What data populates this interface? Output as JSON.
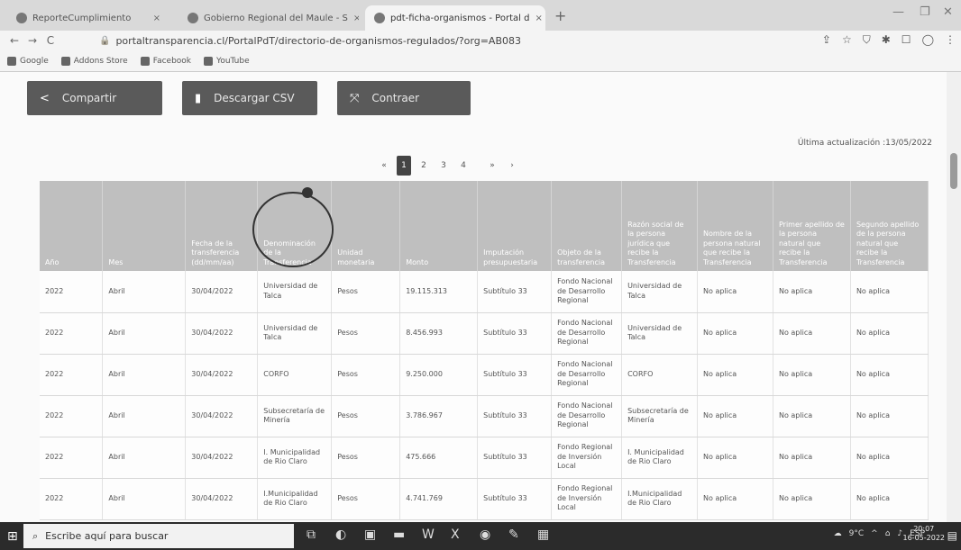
{
  "tabs": [
    {
      "title": "ReporteCumplimiento",
      "close": "×"
    },
    {
      "title": "Gobierno Regional del Maule - S",
      "close": "×"
    },
    {
      "title": "pdt-ficha-organismos - Portal d",
      "close": "×"
    }
  ],
  "window_controls": {
    "new_tab": "+",
    "minimize": "—",
    "restore": "❐",
    "close": "✕"
  },
  "address_bar": {
    "back": "←",
    "forward": "→",
    "reload": "C",
    "url": "portaltransparencia.cl/PortalPdT/directorio-de-organismos-regulados/?org=AB083"
  },
  "bookmarks": [
    "Google",
    "Addons Store",
    "Facebook",
    "YouTube"
  ],
  "actions": {
    "share": {
      "label": "Compartir",
      "icon": "share-icon"
    },
    "csv": {
      "label": "Descargar CSV",
      "icon": "document-icon"
    },
    "collapse": {
      "label": "Contraer",
      "icon": "collapse-icon"
    }
  },
  "last_update": "Última actualización :13/05/2022",
  "pagination": {
    "prev": "«",
    "pages": [
      "1",
      "2",
      "3",
      "4"
    ],
    "active": "1",
    "next_a": "»",
    "next_b": "›"
  },
  "table": {
    "headers": [
      "Año",
      "Mes",
      "Fecha de la transferencia (dd/mm/aa)",
      "Denominación de la Transferencia",
      "Unidad monetaria",
      "Monto",
      "Imputación presupuestaria",
      "Objeto de la transferencia",
      "Razón social de la persona jurídica que recibe la Transferencia",
      "Nombre de la persona natural que recibe la Transferencia",
      "Primer apellido de la persona natural que recibe la Transferencia",
      "Segundo apellido de la persona natural que recibe la Transferencia"
    ],
    "rows": [
      [
        "2022",
        "Abril",
        "30/04/2022",
        "Universidad de Talca",
        "Pesos",
        "19.115.313",
        "Subtítulo 33",
        "Fondo Nacional de Desarrollo Regional",
        "Universidad de Talca",
        "No aplica",
        "No aplica",
        "No aplica"
      ],
      [
        "2022",
        "Abril",
        "30/04/2022",
        "Universidad de Talca",
        "Pesos",
        "8.456.993",
        "Subtítulo 33",
        "Fondo Nacional de Desarrollo Regional",
        "Universidad de Talca",
        "No aplica",
        "No aplica",
        "No aplica"
      ],
      [
        "2022",
        "Abril",
        "30/04/2022",
        "CORFO",
        "Pesos",
        "9.250.000",
        "Subtítulo 33",
        "Fondo Nacional de Desarrollo Regional",
        "CORFO",
        "No aplica",
        "No aplica",
        "No aplica"
      ],
      [
        "2022",
        "Abril",
        "30/04/2022",
        "Subsecretaría de Minería",
        "Pesos",
        "3.786.967",
        "Subtítulo 33",
        "Fondo Nacional de Desarrollo Regional",
        "Subsecretaría de Minería",
        "No aplica",
        "No aplica",
        "No aplica"
      ],
      [
        "2022",
        "Abril",
        "30/04/2022",
        "I. Municipalidad de Rio Claro",
        "Pesos",
        "475.666",
        "Subtítulo 33",
        "Fondo Regional de Inversión Local",
        "I. Municipalidad de Rio Claro",
        "No aplica",
        "No aplica",
        "No aplica"
      ],
      [
        "2022",
        "Abril",
        "30/04/2022",
        "I.Municipalidad de Rio Claro",
        "Pesos",
        "4.741.769",
        "Subtítulo 33",
        "Fondo Regional de Inversión Local",
        "I.Municipalidad de Rio Claro",
        "No aplica",
        "No aplica",
        "No aplica"
      ]
    ]
  },
  "taskbar": {
    "search_placeholder": "Escribe aquí para buscar",
    "weather": "9°C",
    "lang": "ESP",
    "time": "20:07",
    "date": "16-05-2022"
  }
}
